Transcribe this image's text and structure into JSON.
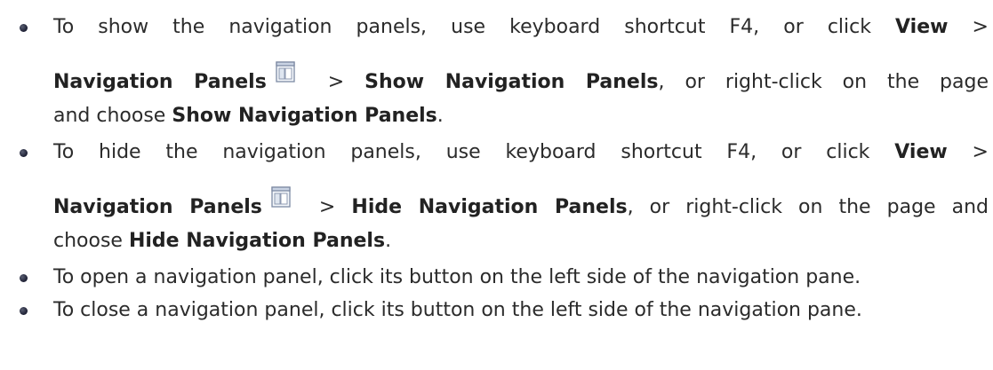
{
  "items": [
    {
      "l1": {
        "t1": "To show the navigation panels, use keyboard shortcut F4, or click ",
        "b1": "View",
        "t2": " >"
      },
      "l2": {
        "b1": "Navigation Panels",
        "icon": "navigation-panels-icon",
        "t1": " > ",
        "b2": "Show Navigation Panels",
        "t2": ", or right-click on the page"
      },
      "l3": {
        "t1": "and choose ",
        "b1": "Show Navigation Panels",
        "t2": "."
      }
    },
    {
      "l1": {
        "t1": "To hide the navigation panels, use keyboard shortcut F4, or click ",
        "b1": "View",
        "t2": " >"
      },
      "l2": {
        "b1": "Navigation Panels",
        "icon": "navigation-panels-icon",
        "t1": " > ",
        "b2": "Hide Navigation Panels",
        "t2": ", or right-click on the page and"
      },
      "l3": {
        "t1": "choose ",
        "b1": "Hide Navigation Panels",
        "t2": "."
      }
    },
    {
      "text": "To open a navigation panel, click its button on the left side of the navigation pane."
    },
    {
      "text": "To close a navigation panel, click its button on the left side of the navigation pane."
    }
  ]
}
